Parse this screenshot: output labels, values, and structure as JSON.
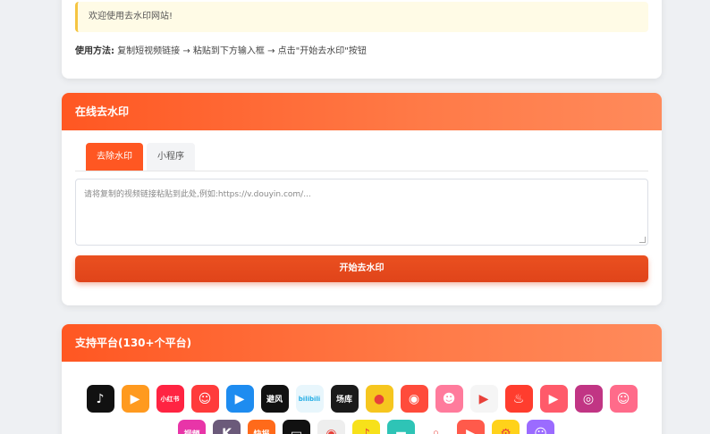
{
  "intro": {
    "notice": "欢迎使用去水印网站!",
    "howto_label": "使用方法:",
    "howto_text": "复制短视频链接 → 粘贴到下方输入框 → 点击\"开始去水印\"按钮"
  },
  "main": {
    "title": "在线去水印",
    "tabs": [
      {
        "label": "去除水印",
        "active": true
      },
      {
        "label": "小程序",
        "active": false
      }
    ],
    "input_placeholder": "请将复制的视频链接粘贴到此处,例如:https://v.douyin.com/...",
    "start_button": "开始去水印"
  },
  "platforms": {
    "title": "支持平台(130+个平台)",
    "row1": [
      {
        "icon": "tiktok-icon",
        "bg": "#111111",
        "glyph": "♪"
      },
      {
        "icon": "kuaishou-icon",
        "bg": "#ff9a1f",
        "glyph": "▶"
      },
      {
        "icon": "xiaohongshu-icon",
        "bg": "#ff2442",
        "glyph": "小红书"
      },
      {
        "icon": "cartoon-face-icon",
        "bg": "#ff3b3b",
        "glyph": "☺"
      },
      {
        "icon": "play-circle-icon",
        "bg": "#1e8cf0",
        "glyph": "▶"
      },
      {
        "icon": "bi-logo-icon",
        "bg": "#111111",
        "glyph": "避风"
      },
      {
        "icon": "bilibili-icon",
        "bg": "#e8f6fc",
        "glyph": "bilibili"
      },
      {
        "icon": "changku-icon",
        "bg": "#1a1a1a",
        "glyph": "场库"
      },
      {
        "icon": "yellow-face-icon",
        "bg": "#f6c61f",
        "glyph": "●"
      },
      {
        "icon": "monkey-icon",
        "bg": "#ff4b3b",
        "glyph": "◉"
      },
      {
        "icon": "pink-face-icon",
        "bg": "#ff7b9c",
        "glyph": "☻"
      },
      {
        "icon": "play-triangle-icon",
        "bg": "#f5f5f5",
        "glyph": "▶"
      },
      {
        "icon": "flame-icon",
        "bg": "#ff3d2e",
        "glyph": "♨"
      },
      {
        "icon": "video-frame-icon",
        "bg": "#ff5a6a",
        "glyph": "▶"
      },
      {
        "icon": "instagram-icon",
        "bg": "#c13584",
        "glyph": "◎"
      },
      {
        "icon": "avatar-face-icon",
        "bg": "#ff6b8a",
        "glyph": "☺"
      }
    ],
    "row2": [
      {
        "icon": "video-text-icon",
        "bg": "#e835a8",
        "glyph": "视频"
      },
      {
        "icon": "k-logo-icon",
        "bg": "#6b5a7a",
        "glyph": "K"
      },
      {
        "icon": "kuaibao-icon",
        "bg": "#ff6a1a",
        "glyph": "快报"
      },
      {
        "icon": "tv-icon",
        "bg": "#111111",
        "glyph": "▭"
      },
      {
        "icon": "camera-lens-icon",
        "bg": "#eeeeee",
        "glyph": "◉"
      },
      {
        "icon": "leaf-icon",
        "bg": "#f7e11a",
        "glyph": "♪"
      },
      {
        "icon": "cup-icon",
        "bg": "#2ec4b6",
        "glyph": "▬"
      },
      {
        "icon": "map-pin-icon",
        "bg": "#ffffff",
        "glyph": "◦"
      },
      {
        "icon": "video-red-icon",
        "bg": "#ff5a4b",
        "glyph": "▶"
      },
      {
        "icon": "gear-yellow-icon",
        "bg": "#ffd21a",
        "glyph": "⚙"
      },
      {
        "icon": "purple-face-icon",
        "bg": "#9b6bff",
        "glyph": "☺"
      }
    ]
  }
}
